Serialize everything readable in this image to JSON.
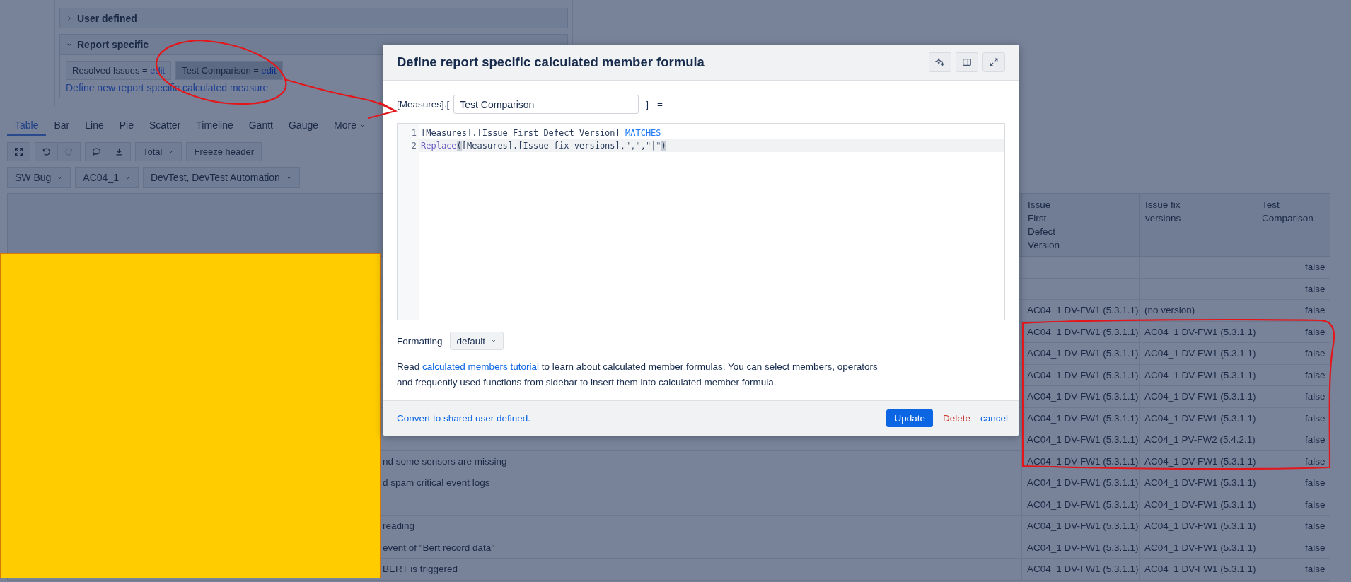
{
  "side_panel": {
    "sections": [
      {
        "title": "User defined",
        "expanded": false
      },
      {
        "title": "Report specific",
        "expanded": true,
        "measures": [
          {
            "name": "Resolved Issues",
            "equals": "=",
            "action": "edit",
            "selected": false
          },
          {
            "name": "Test Comparison",
            "equals": "=",
            "action": "edit",
            "selected": true
          }
        ],
        "link": "Define new report specific calculated measure"
      }
    ]
  },
  "chart_tabs": [
    {
      "label": "Table",
      "selected": true
    },
    {
      "label": "Bar",
      "selected": false
    },
    {
      "label": "Line",
      "selected": false
    },
    {
      "label": "Pie",
      "selected": false
    },
    {
      "label": "Scatter",
      "selected": false
    },
    {
      "label": "Timeline",
      "selected": false
    },
    {
      "label": "Gantt",
      "selected": false
    },
    {
      "label": "Gauge",
      "selected": false
    },
    {
      "label": "More",
      "selected": false,
      "kind": "dropdown"
    }
  ],
  "toolbar": {
    "icon_groups": [
      [
        {
          "disabled": false
        }
      ],
      [
        {
          "disabled": false
        },
        {
          "disabled": true
        }
      ],
      [
        {
          "disabled": false
        },
        {
          "disabled": false
        }
      ]
    ],
    "total_dropdown": "Total",
    "freeze_button": "Freeze header"
  },
  "filters": [
    "SW Bug",
    "AC04_1",
    "DevTest, DevTest Automation"
  ],
  "table": {
    "columns": [
      "Issue\nFirst\nDefect\nVersion",
      "Issue fix\nversions",
      "Test\nComparison"
    ],
    "rows": [
      {
        "first_defect_version": "",
        "fix_versions": "",
        "test_comparison": "false"
      },
      {
        "first_defect_version": "",
        "fix_versions": "",
        "test_comparison": "false"
      },
      {
        "first_defect_version": "AC04_1 DV-FW1 (5.3.1.1)",
        "fix_versions": "(no version)",
        "test_comparison": "false"
      },
      {
        "first_defect_version": "AC04_1 DV-FW1 (5.3.1.1)",
        "fix_versions": "AC04_1 DV-FW1 (5.3.1.1)",
        "test_comparison": "false"
      },
      {
        "first_defect_version": "AC04_1 DV-FW1 (5.3.1.1)",
        "fix_versions": "AC04_1 DV-FW1 (5.3.1.1)",
        "test_comparison": "false"
      },
      {
        "first_defect_version": "AC04_1 DV-FW1 (5.3.1.1)",
        "fix_versions": "AC04_1 DV-FW1 (5.3.1.1)",
        "test_comparison": "false"
      },
      {
        "first_defect_version": "AC04_1 DV-FW1 (5.3.1.1)",
        "fix_versions": "AC04_1 DV-FW1 (5.3.1.1)",
        "test_comparison": "false"
      },
      {
        "first_defect_version": "AC04_1 DV-FW1 (5.3.1.1)",
        "fix_versions": "AC04_1 DV-FW1 (5.3.1.1)",
        "test_comparison": "false"
      },
      {
        "first_defect_version": "AC04_1 DV-FW1 (5.3.1.1)",
        "fix_versions": "AC04_1 PV-FW2 (5.4.2.1)",
        "test_comparison": "false"
      },
      {
        "summary": "nd some sensors are missing",
        "first_defect_version": "AC04_1 DV-FW1 (5.3.1.1)",
        "fix_versions": "AC04_1 DV-FW1 (5.3.1.1)",
        "test_comparison": "false"
      },
      {
        "summary": "d spam critical event logs",
        "first_defect_version": "AC04_1 DV-FW1 (5.3.1.1)",
        "fix_versions": "AC04_1 DV-FW1 (5.3.1.1)",
        "test_comparison": "false"
      },
      {
        "first_defect_version": "AC04_1 DV-FW1 (5.3.1.1)",
        "fix_versions": "AC04_1 DV-FW1 (5.3.1.1)",
        "test_comparison": "false"
      },
      {
        "summary": "reading",
        "first_defect_version": "AC04_1 DV-FW1 (5.3.1.1)",
        "fix_versions": "AC04_1 DV-FW1 (5.3.1.1)",
        "test_comparison": "false"
      },
      {
        "summary": "event of \"Bert record data\"",
        "first_defect_version": "AC04_1 DV-FW1 (5.3.1.1)",
        "fix_versions": "AC04_1 DV-FW1 (5.3.1.1)",
        "test_comparison": "false"
      },
      {
        "summary": "BERT is triggered",
        "first_defect_version": "AC04_1 DV-FW1 (5.3.1.1)",
        "fix_versions": "AC04_1 DV-FW1 (5.3.1.1)",
        "test_comparison": "false"
      }
    ]
  },
  "dialog": {
    "title": "Define report specific calculated member formula",
    "formula": {
      "prefix": "[Measures].[",
      "name_value": "Test Comparison",
      "suffix": "]",
      "equals": "="
    },
    "editor_lines": [
      {
        "number": "1",
        "active": false,
        "tokens": [
          {
            "kind": "plain",
            "text": "[Measures].[Issue First Defect Version]"
          },
          {
            "kind": "keyword",
            "text": " MATCHES"
          }
        ]
      },
      {
        "number": "2",
        "active": true,
        "tokens": [
          {
            "kind": "function",
            "text": "Replace"
          },
          {
            "kind": "match",
            "text": "("
          },
          {
            "kind": "plain",
            "text": "[Measures].[Issue fix versions],"
          },
          {
            "kind": "string",
            "text": "\",\""
          },
          {
            "kind": "plain",
            "text": ","
          },
          {
            "kind": "string",
            "text": "\"|\""
          },
          {
            "kind": "match",
            "text": ")"
          }
        ]
      }
    ],
    "formatting": {
      "label": "Formatting",
      "value": "default"
    },
    "help": {
      "before": "Read ",
      "link": "calculated members tutorial",
      "after": " to learn about calculated member formulas. You can select members, operators and frequently used functions from sidebar to insert them into calculated member formula."
    },
    "footer": {
      "link": "Convert to shared user defined.",
      "actions": [
        {
          "kind": "primary",
          "label": "Update"
        },
        {
          "kind": "danger",
          "label": "Delete"
        },
        {
          "kind": "link",
          "label": "cancel"
        }
      ]
    }
  }
}
